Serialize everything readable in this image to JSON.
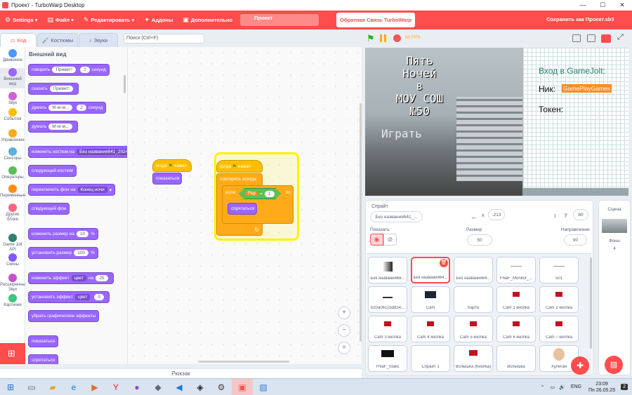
{
  "window": {
    "title": "Проект - TurboWarp Desktop",
    "min": "—",
    "max": "☐",
    "close": "✕"
  },
  "menu": {
    "settings": "Settings",
    "file": "Файл",
    "edit": "Редактировать",
    "addons": "Аддоны",
    "advanced": "Дополнительно",
    "project_title": "Проект",
    "feedback": "Обратная Связь TurboWarp",
    "save_as": "Сохранить как Проект.sb3"
  },
  "tabs": {
    "code": "Код",
    "costumes": "Костюмы",
    "sounds": "Звуки"
  },
  "search": {
    "placeholder": "Поиск (Ctrl+F)"
  },
  "categories": [
    {
      "label": "Движение",
      "color": "#4c97ff"
    },
    {
      "label": "Внешний вид",
      "color": "#9966ff"
    },
    {
      "label": "Звук",
      "color": "#cf63cf"
    },
    {
      "label": "События",
      "color": "#ffbf00"
    },
    {
      "label": "Управление",
      "color": "#ffab19"
    },
    {
      "label": "Сенсоры",
      "color": "#5cb1d6"
    },
    {
      "label": "Операторы",
      "color": "#59c059"
    },
    {
      "label": "Переменные",
      "color": "#ff8c1a"
    },
    {
      "label": "Другие блоки",
      "color": "#ff6680"
    },
    {
      "label": "Game Jolt API",
      "color": "#2f7f6f"
    },
    {
      "label": "Скины",
      "color": "#7f5cff"
    },
    {
      "label": "Расширенный Звук",
      "color": "#c94fc9"
    },
    {
      "label": "Картинки",
      "color": "#3fc47f"
    }
  ],
  "palette": {
    "title": "Внешний вид",
    "say_for": {
      "a": "говорить",
      "msg": "Привет!",
      "n": "2",
      "b": "секунд"
    },
    "say": {
      "a": "сказать",
      "msg": "Привет!"
    },
    "think_for": {
      "a": "думать",
      "msg": "М-м-м...",
      "n": "2",
      "b": "секунд"
    },
    "think": {
      "a": "думать",
      "msg": "М-м-м..."
    },
    "switch_costume": {
      "a": "изменить костюм на",
      "v": "Без названия641_20241"
    },
    "next_costume": "следующий костюм",
    "switch_backdrop": {
      "a": "переключить фон на",
      "v": "Конец ночи"
    },
    "next_backdrop": "следующий фон",
    "change_size": {
      "a": "изменить размер на",
      "n": "10",
      "b": "%"
    },
    "set_size": {
      "a": "установить размер",
      "n": "100",
      "b": "%"
    },
    "change_effect": {
      "a": "изменить эффект",
      "v": "цвет",
      "on": "на",
      "n": "25"
    },
    "set_effect": {
      "a": "установить эффект",
      "v": "цвет",
      "n": "0"
    },
    "clear_effects": "убрать графические эффекты",
    "show": "показаться",
    "hide": "спрятаться"
  },
  "script1": {
    "hat_a": "когда",
    "hat_b": "нажат",
    "show": "показаться"
  },
  "script2": {
    "hat_a": "когда",
    "hat_b": "нажат",
    "forever": "повторять всегда",
    "if": "если",
    "var": "Play",
    "eq": "=",
    "num": "1",
    "then": "то",
    "hide": "спрятаться"
  },
  "zoom": {
    "in": "+",
    "out": "−",
    "reset": "="
  },
  "backpack": "Рюкзак",
  "stagebar": {
    "fps": "60 FPS"
  },
  "stage": {
    "title_lines": [
      "Пять",
      "Ночей",
      "в",
      "МОУ СОШ",
      "№50"
    ],
    "play": "Играть",
    "gj_title": "Вход в GameJolt:",
    "nick_label": "Ник:",
    "nick_value": "GamePlayGames",
    "token_label": "Токен:"
  },
  "sprite_info": {
    "sprite_label": "Спрайт",
    "sprite_name": "Без названия641_...",
    "x_label": "x",
    "x_value": "-213",
    "y_label": "y",
    "y_value": "80",
    "show_label": "Показать",
    "size_label": "Размер",
    "size_value": "50",
    "direction_label": "Направление",
    "direction_value": "90"
  },
  "sprites": [
    "Без названия68...",
    "Без названия64...",
    "Без названия64...",
    "FNaF_Monitor_...",
    "501",
    "b20a061c5dd14...",
    "Cam",
    "Карта",
    "Cam 1 кнопка",
    "Cam 2 кнопка",
    "Cam 3 кнопка",
    "Cam 4 кнопка",
    "Cam 5 кнопка",
    "Cam 6 кнопка",
    "Cam 7 кнопка",
    "FNaF_Static",
    "Спрайт 1",
    "Вспышка (Кнопка)",
    "Вспышка",
    "Хулиган"
  ],
  "scene": {
    "label": "Сцена",
    "backdrops_label": "Фоны",
    "backdrops_count": "4"
  },
  "taskbar": {
    "lang": "ENG",
    "time": "23:09",
    "date": "Пн 26.05.25",
    "notif": "2"
  },
  "colors": {
    "accent": "#ff4c4c",
    "looks": "#9966ff",
    "events": "#ffbf00",
    "control": "#ffab19",
    "operators": "#59c059"
  }
}
